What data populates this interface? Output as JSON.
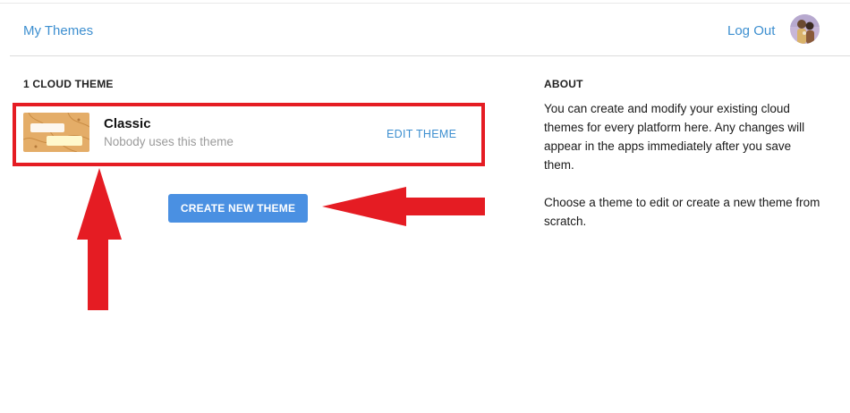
{
  "header": {
    "my_themes_label": "My Themes",
    "logout_label": "Log Out",
    "avatar_icon": "user-avatar"
  },
  "themes": {
    "section_title": "1 CLOUD THEME",
    "items": [
      {
        "name": "Classic",
        "usage": "Nobody uses this theme",
        "edit_label": "EDIT THEME"
      }
    ],
    "create_button_label": "CREATE NEW THEME"
  },
  "about": {
    "title": "ABOUT",
    "paragraph1": "You can create and modify your existing cloud themes for every platform here. Any changes will appear in the apps immediately after you save them.",
    "paragraph2": "Choose a theme to edit or create a new theme from scratch."
  },
  "colors": {
    "link": "#3d8fd0",
    "button": "#4a90e2",
    "annotation_red": "#e51c23",
    "thumb": "#e4ad68"
  }
}
